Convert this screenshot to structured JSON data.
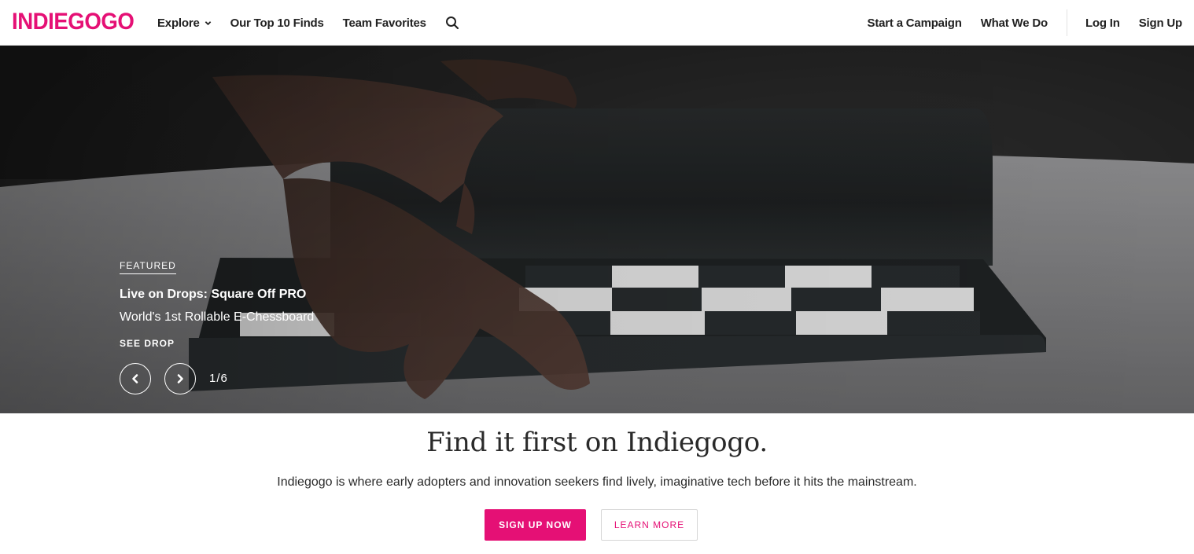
{
  "header": {
    "logo": "INDIEGOGO",
    "nav_left": {
      "explore": "Explore",
      "top10": "Our Top 10 Finds",
      "favorites": "Team Favorites"
    },
    "nav_right": {
      "start_campaign": "Start a Campaign",
      "what_we_do": "What We Do",
      "log_in": "Log In",
      "sign_up": "Sign Up"
    },
    "icons": {
      "explore_caret": "chevron-down-icon",
      "search": "search-icon"
    }
  },
  "hero": {
    "eyebrow": "FEATURED",
    "title": "Live on Drops: Square Off PRO",
    "subtitle": "World's 1st Rollable E-Chessboard",
    "cta": "SEE DROP",
    "counter": "1/6",
    "icons": {
      "prev": "chevron-left-icon",
      "next": "chevron-right-icon"
    }
  },
  "intro": {
    "headline": "Find it first on Indiegogo.",
    "tagline": "Indiegogo is where early adopters and innovation seekers find lively, imaginative tech before it hits the mainstream.",
    "primary_button": "SIGN UP NOW",
    "secondary_button": "LEARN MORE"
  },
  "colors": {
    "brand": "#e51075",
    "text": "#2a2a2a",
    "hero_text": "#ffffff"
  }
}
